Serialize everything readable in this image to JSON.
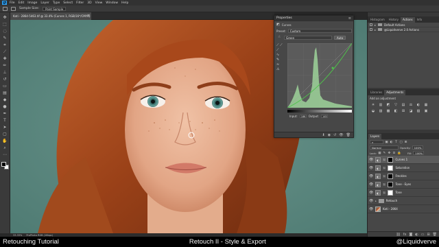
{
  "app": {
    "logo": "Ps"
  },
  "menu": [
    "File",
    "Edit",
    "Image",
    "Layer",
    "Type",
    "Select",
    "Filter",
    "3D",
    "View",
    "Window",
    "Help"
  ],
  "options": {
    "sample_label": "Sample Size:",
    "sample_value": "Point Sample"
  },
  "document": {
    "tab_title": "Kati - 2864-5463.tif @ 33.4% (Curves 1, RGB/16*/CMYK) *",
    "zoom": "33.33%",
    "doc_info": "ProPhoto RGB (16bpc)"
  },
  "properties": {
    "title": "Properties",
    "section": "Curves",
    "preset_label": "Preset:",
    "preset_value": "Custom",
    "channel_value": "Green",
    "auto_label": "Auto",
    "input_label": "Input:",
    "input_value": "186",
    "output_label": "Output:",
    "output_value": "145",
    "colors": {
      "histogram": "#9dd49a",
      "curve": "#4fc34b"
    }
  },
  "top_tabs": [
    "Histogram",
    "History",
    "Actions",
    "Info"
  ],
  "top_active": "Actions",
  "actions": [
    {
      "label": "Default Actions"
    },
    {
      "label": "@Liquidverve 2.0 Actions"
    }
  ],
  "adj_tabs": [
    "Libraries",
    "Adjustments"
  ],
  "adj_active": "Adjustments",
  "adj_header": "Add an adjustment",
  "adj_icons": [
    "☀",
    "▥",
    "◩",
    "▽",
    "▤",
    "⚖",
    "◐",
    "▦",
    "◒",
    "▨",
    "▩",
    "◧",
    "⊞",
    "◪",
    "▧",
    "▣"
  ],
  "layers": {
    "tab": "Layers",
    "blend": "Normal",
    "opacity_label": "Opacity:",
    "opacity": "100%",
    "lock_label": "Lock:",
    "fill_label": "Fill:",
    "fill": "100%",
    "items": [
      {
        "name": "Curves 1",
        "kind": "adj",
        "mask": "black",
        "selected": true
      },
      {
        "name": "Saturation",
        "kind": "adj",
        "mask": "white",
        "selected": false
      },
      {
        "name": "Freckles",
        "kind": "adj",
        "mask": "black",
        "selected": false
      },
      {
        "name": "Tone - Eyes",
        "kind": "adj",
        "mask": "black",
        "selected": false
      },
      {
        "name": "Tone",
        "kind": "adj",
        "mask": "white",
        "selected": false
      },
      {
        "name": "Retouch",
        "kind": "folder",
        "selected": false
      },
      {
        "name": "Kati - 2864",
        "kind": "photo",
        "selected": false
      }
    ]
  },
  "caption": {
    "left": "Retouching Tutorial",
    "center": "Retouch II - Style & Export",
    "right": "@Liquidverve"
  }
}
